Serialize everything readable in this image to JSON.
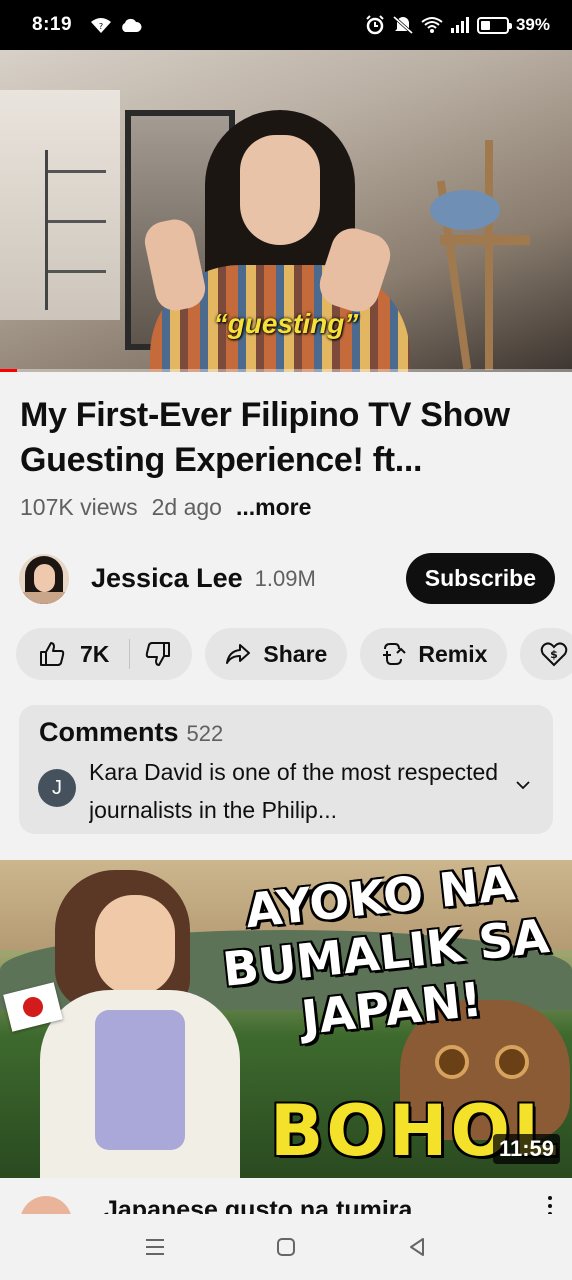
{
  "status_bar": {
    "time": "8:19",
    "battery": "39%",
    "battery_level": 0.39
  },
  "player": {
    "caption": "“guesting”",
    "progress": 0.03
  },
  "video": {
    "title": "My First-Ever Filipino TV Show Guesting Experience! ft...",
    "views": "107K views",
    "age": "2d ago",
    "more": "...more"
  },
  "channel": {
    "name": "Jessica Lee",
    "subscribers": "1.09M",
    "subscribe_label": "Subscribe"
  },
  "actions": {
    "likes": "7K",
    "share": "Share",
    "remix": "Remix"
  },
  "comments": {
    "label": "Comments",
    "count": "522",
    "avatar_initial": "J",
    "top_comment": "Kara David is one of the most respected journalists in the Philip..."
  },
  "next_video": {
    "thumb_text": "AYOKO NA BUMALIK SA JAPAN!",
    "thumb_place": "BOHOL",
    "duration": "11:59",
    "title": "Japanese gusto na tumira"
  },
  "colors": {
    "accent_red": "#ff0000",
    "caption_yellow": "#f5e13a",
    "pill_bg": "#e5e5e5"
  },
  "icons": [
    "wifi-question-icon",
    "cloud-icon",
    "alarm-icon",
    "mute-icon",
    "wifi-icon",
    "signal-icon",
    "battery-icon",
    "thumbs-up-icon",
    "thumbs-down-icon",
    "share-icon",
    "remix-icon",
    "thanks-icon",
    "chevron-down-icon",
    "menu-icon",
    "home-icon",
    "back-icon"
  ]
}
